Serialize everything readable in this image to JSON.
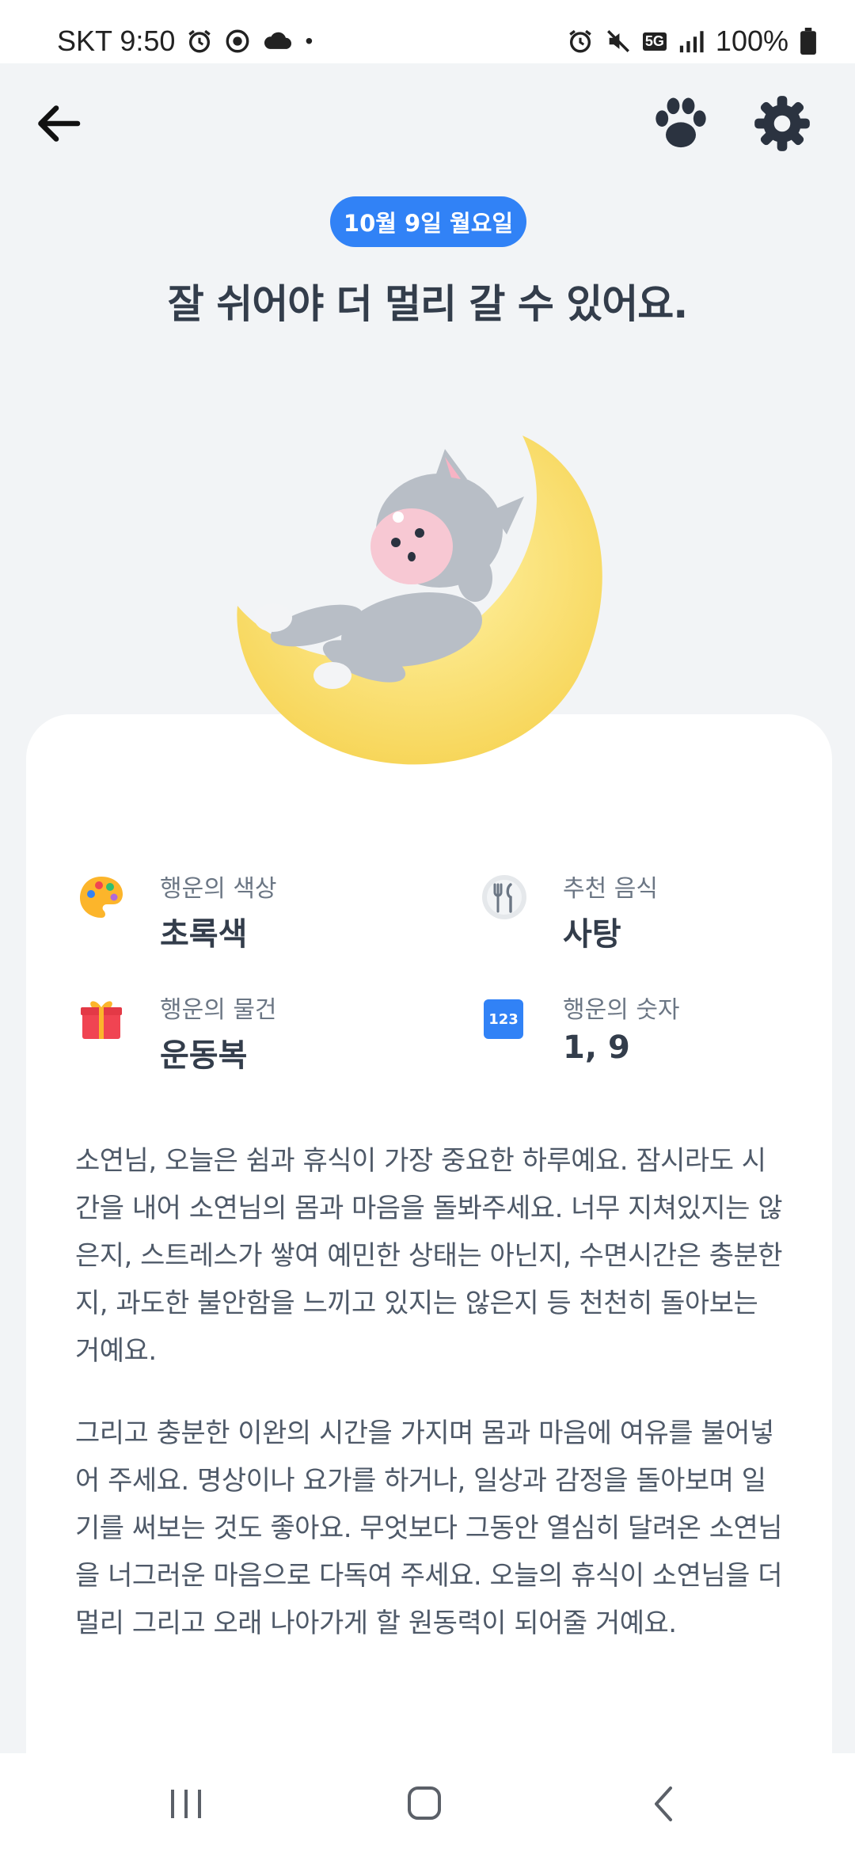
{
  "status_bar": {
    "carrier_time": "SKT 9:50",
    "dot": "•",
    "network": "5G",
    "battery": "100%"
  },
  "app_bar": {
    "icons": [
      "back-arrow-icon",
      "paw-icon",
      "gear-icon"
    ]
  },
  "date": "10월 9일 월요일",
  "headline": "잘 쉬어야 더 멀리 갈 수 있어요.",
  "fortune": {
    "color": {
      "label": "행운의 색상",
      "value": "초록색",
      "icon": "palette-icon"
    },
    "food": {
      "label": "추천 음식",
      "value": "사탕",
      "icon": "fork-knife-icon"
    },
    "item": {
      "label": "행운의 물건",
      "value": "운동복",
      "icon": "gift-icon"
    },
    "number": {
      "label": "행운의 숫자",
      "value": "1, 9",
      "icon": "number-123-icon",
      "icon_text": "123"
    }
  },
  "body": {
    "paragraph1": "소연님, 오늘은 쉼과 휴식이 가장 중요한 하루예요. 잠시라도 시간을 내어 소연님의 몸과 마음을 돌봐주세요. 너무 지쳐있지는 않은지, 스트레스가 쌓여 예민한 상태는 아닌지, 수면시간은 충분한지, 과도한 불안함을 느끼고 있지는 않은지 등 천천히 돌아보는 거예요.",
    "paragraph2": "그리고 충분한 이완의 시간을 가지며 몸과 마음에 여유를 불어넣어 주세요. 명상이나 요가를 하거나, 일상과 감정을 돌아보며 일기를 써보는 것도 좋아요. 무엇보다 그동안 열심히 달려온 소연님을 너그러운 마음으로 다독여 주세요. 오늘의 휴식이 소연님을 더 멀리 그리고 오래 나아가게 할 원동력이 되어줄 거예요."
  },
  "colors": {
    "accent": "#3182f6",
    "background": "#f2f4f6",
    "card": "#ffffff",
    "moon": "#fbe27a"
  }
}
